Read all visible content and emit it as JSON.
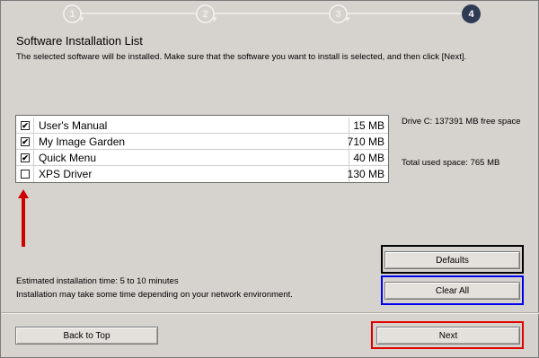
{
  "stepper": {
    "steps": [
      "1",
      "2",
      "3",
      "4"
    ],
    "active_step": 4
  },
  "header": {
    "title": "Software Installation List",
    "subtitle": "The selected software will be installed. Make sure that the software you want to install is selected, and then click [Next]."
  },
  "software_list": {
    "items": [
      {
        "name": "User's Manual",
        "size": "15 MB",
        "checked": true
      },
      {
        "name": "My Image Garden",
        "size": "710 MB",
        "checked": true
      },
      {
        "name": "Quick Menu",
        "size": "40 MB",
        "checked": true
      },
      {
        "name": "XPS Driver",
        "size": "130 MB",
        "checked": false
      }
    ]
  },
  "disk_info": {
    "free_space": "Drive C: 137391 MB free space",
    "used_space": "Total used space: 765 MB"
  },
  "install_info": {
    "estimated_time": "Estimated installation time: 5 to 10 minutes",
    "note": "Installation may take some time depending on your network environment."
  },
  "buttons": {
    "defaults": "Defaults",
    "clear_all": "Clear All",
    "back_to_top": "Back to Top",
    "next": "Next"
  },
  "annotations": {
    "arrow_color": "#d00000",
    "defaults_box_color": "#000000",
    "clear_all_box_color": "#0000ee",
    "next_box_color": "#e00000"
  }
}
